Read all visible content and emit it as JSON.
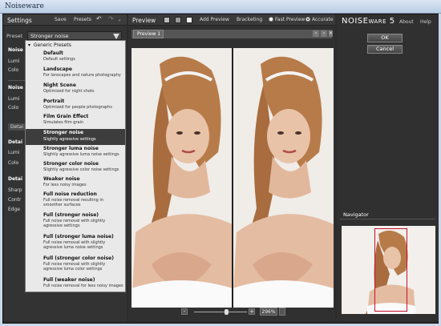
{
  "window": {
    "title": "Noiseware"
  },
  "settings": {
    "title": "Settings",
    "save_label": "Save",
    "presets_label": "Presets",
    "preset_label": "Preset",
    "preset_value": "Stronger noise",
    "sections": [
      {
        "label": "Noise"
      },
      {
        "label": "Lumi"
      },
      {
        "label": "Colo"
      },
      {
        "label": "Noise"
      },
      {
        "label": "Lumi"
      },
      {
        "label": "Colo"
      },
      {
        "label": "Detai"
      },
      {
        "label": "Detai"
      },
      {
        "label": "Lumi"
      },
      {
        "label": "Colo"
      },
      {
        "label": "Detai"
      },
      {
        "label": "Sharp"
      },
      {
        "label": "Contr"
      },
      {
        "label": "Edge"
      }
    ],
    "dropdown": {
      "group": "Generic Presets",
      "items": [
        {
          "name": "Default",
          "desc": "Default settings"
        },
        {
          "name": "Landscape",
          "desc": "For lanscapes and nature photography"
        },
        {
          "name": "Night Scene",
          "desc": "Optimized for night shots"
        },
        {
          "name": "Portrait",
          "desc": "Optimized for people photographs"
        },
        {
          "name": "Film Grain Effect",
          "desc": "Simulates film grain"
        },
        {
          "name": "Stronger noise",
          "desc": "Slightly agressive settings"
        },
        {
          "name": "Stronger luma noise",
          "desc": "Slightly agressive luma noise settings"
        },
        {
          "name": "Stronger color noise",
          "desc": "Slightly agressive color noise settings"
        },
        {
          "name": "Weaker noise",
          "desc": "For less noisy images"
        },
        {
          "name": "Full noise reduction",
          "desc": "Full noise removal resulting in smoother surfaces"
        },
        {
          "name": "Full (stronger noise)",
          "desc": "Full noise removal with slightly agressive settings"
        },
        {
          "name": "Full (stronger luma noise)",
          "desc": "Full noise removal with slightly agressive luma noise settings"
        },
        {
          "name": "Full (stronger color noise)",
          "desc": "Full noise removal with slightly agressive luma color settings"
        },
        {
          "name": "Full (weaker noise)",
          "desc": "Full noise removal for less noisy images"
        }
      ]
    }
  },
  "preview": {
    "title": "Preview",
    "add_preview": "Add Preview",
    "bracketing": "Bracketing",
    "fast_preview": "Fast Preview",
    "accurate": "Accurate",
    "accurate_selected": true,
    "tab": "Preview 1",
    "zoom": "296%",
    "zoom_level": 0.6
  },
  "right": {
    "logo_main": "NOISE",
    "logo_sub": "WARE",
    "logo_version": "5",
    "about": "About",
    "help": "Help",
    "ok": "OK",
    "cancel": "Cancel",
    "navigator": "Navigator"
  },
  "colors": {
    "panel_bg": "#303030",
    "dropdown_bg": "#e9e9e9",
    "selected_item": "#3d3d3d",
    "nav_rect": "#c8102e"
  }
}
